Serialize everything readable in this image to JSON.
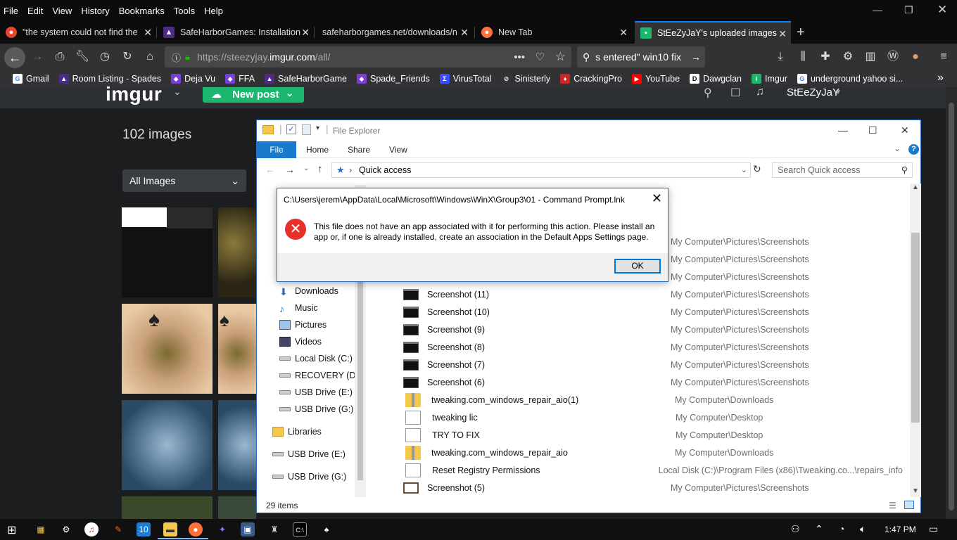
{
  "menubar": [
    "File",
    "Edit",
    "View",
    "History",
    "Bookmarks",
    "Tools",
    "Help"
  ],
  "tabs": [
    {
      "title": "\"the system could not find the"
    },
    {
      "title": "SafeHarborGames: Installation"
    },
    {
      "title": "safeharborgames.net/downloads/n"
    },
    {
      "title": "New Tab"
    },
    {
      "title": "StEeZyJaY's uploaded images"
    }
  ],
  "url": {
    "prefix": "https://steezyjay.",
    "domain": "imgur.com",
    "suffix": "/all/"
  },
  "search": {
    "value": "s entered\" win10 fix"
  },
  "bookmarks": [
    {
      "label": "Gmail",
      "color": "#fff",
      "glyph": "G",
      "fg": "#4285f4"
    },
    {
      "label": "Room Listing - Spades",
      "color": "#4b2b86",
      "glyph": "▲",
      "fg": "#fff"
    },
    {
      "label": "Deja Vu",
      "color": "#7a3ed6",
      "glyph": "◆",
      "fg": "#fff"
    },
    {
      "label": "FFA",
      "color": "#7a3ed6",
      "glyph": "◆",
      "fg": "#fff"
    },
    {
      "label": "SafeHarborGame",
      "color": "#4b2b86",
      "glyph": "▲",
      "fg": "#fff"
    },
    {
      "label": "Spade_Friends",
      "color": "#7a3ed6",
      "glyph": "◆",
      "fg": "#fff"
    },
    {
      "label": "VirusTotal",
      "color": "#394eff",
      "glyph": "Σ",
      "fg": "#fff"
    },
    {
      "label": "Sinisterly",
      "color": "#333",
      "glyph": "⊘",
      "fg": "#fff"
    },
    {
      "label": "CrackingPro",
      "color": "#c62828",
      "glyph": "♦",
      "fg": "#fff"
    },
    {
      "label": "YouTube",
      "color": "#ff0000",
      "glyph": "▶",
      "fg": "#fff"
    },
    {
      "label": "Dawgclan",
      "color": "#fff",
      "glyph": "D",
      "fg": "#000"
    },
    {
      "label": "Imgur",
      "color": "#1bb76e",
      "glyph": "i",
      "fg": "#fff"
    },
    {
      "label": "underground yahoo si...",
      "color": "#fff",
      "glyph": "G",
      "fg": "#4285f4"
    }
  ],
  "imgur": {
    "logo": "imgur",
    "new_post": "New post",
    "user": "StEeZyJaY",
    "count": "102 images",
    "filter": "All Images"
  },
  "explorer": {
    "title": "File Explorer",
    "ribbon": [
      "File",
      "Home",
      "Share",
      "View"
    ],
    "address": "Quick access",
    "search_placeholder": "Search Quick access",
    "nav": [
      "Downloads",
      "Music",
      "Pictures",
      "Videos",
      "Local Disk (C:)",
      "RECOVERY (D:)",
      "USB Drive (E:)",
      "USB Drive (G:)",
      "Libraries",
      "USB Drive (E:)",
      "USB Drive (G:)"
    ],
    "hidden_locations": [
      "My Computer\\Pictures\\Screenshots",
      "My Computer\\Pictures\\Screenshots",
      "My Computer\\Pictures\\Screenshots"
    ],
    "files": [
      {
        "name": "Screenshot (11)",
        "location": "My Computer\\Pictures\\Screenshots",
        "icon": "screenshot-icon"
      },
      {
        "name": "Screenshot (10)",
        "location": "My Computer\\Pictures\\Screenshots",
        "icon": "screenshot-icon"
      },
      {
        "name": "Screenshot (9)",
        "location": "My Computer\\Pictures\\Screenshots",
        "icon": "screenshot-icon"
      },
      {
        "name": "Screenshot (8)",
        "location": "My Computer\\Pictures\\Screenshots",
        "icon": "screenshot-icon"
      },
      {
        "name": "Screenshot (7)",
        "location": "My Computer\\Pictures\\Screenshots",
        "icon": "screenshot-icon"
      },
      {
        "name": "Screenshot (6)",
        "location": "My Computer\\Pictures\\Screenshots",
        "icon": "screenshot-icon"
      },
      {
        "name": "tweaking.com_windows_repair_aio(1)",
        "location": "My Computer\\Downloads",
        "icon": "zip-folder-icon"
      },
      {
        "name": "tweaking lic",
        "location": "My Computer\\Desktop",
        "icon": "document-icon"
      },
      {
        "name": "TRY TO FIX",
        "location": "My Computer\\Desktop",
        "icon": "document-icon"
      },
      {
        "name": "tweaking.com_windows_repair_aio",
        "location": "My Computer\\Downloads",
        "icon": "zip-folder-icon"
      },
      {
        "name": "Reset Registry Permissions",
        "location": "Local Disk (C:)\\Program Files (x86)\\Tweaking.co...\\repairs_info",
        "icon": "document-icon"
      },
      {
        "name": "Screenshot (5)",
        "location": "My Computer\\Pictures\\Screenshots",
        "icon": "screenshot-icon"
      }
    ],
    "status": "29 items"
  },
  "dialog": {
    "title": "C:\\Users\\jerem\\AppData\\Local\\Microsoft\\Windows\\WinX\\Group3\\01 - Command Prompt.lnk",
    "message": "This file does not have an app associated with it for performing this action. Please install an app or, if one is already installed, create an association in the Default Apps Settings page.",
    "ok": "OK"
  },
  "taskbar": {
    "time": "1:47 PM"
  }
}
